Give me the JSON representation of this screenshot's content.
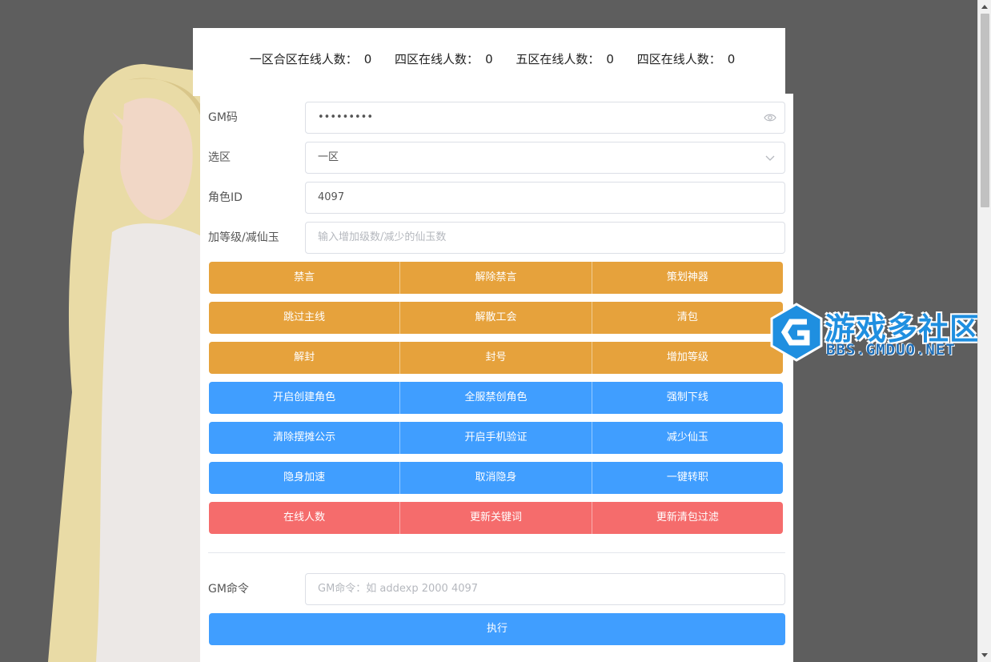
{
  "header": {
    "stats": [
      {
        "label": "一区合区在线人数：",
        "value": "0"
      },
      {
        "label": "四区在线人数：",
        "value": "0"
      },
      {
        "label": "五区在线人数：",
        "value": "0"
      },
      {
        "label": "四区在线人数：",
        "value": "0"
      }
    ]
  },
  "form": {
    "gm_code": {
      "label": "GM码",
      "value": "•••••••••",
      "icon": "eye-icon"
    },
    "zone": {
      "label": "选区",
      "value": "一区",
      "icon": "chevron-down-icon"
    },
    "role_id": {
      "label": "角色ID",
      "value": "4097"
    },
    "level": {
      "label": "加等级/减仙玉",
      "placeholder": "输入增加级数/减少的仙玉数"
    },
    "button_rows": [
      {
        "color": "#e6a23c",
        "buttons": [
          "禁言",
          "解除禁言",
          "策划神器"
        ]
      },
      {
        "color": "#e6a23c",
        "buttons": [
          "跳过主线",
          "解散工会",
          "清包"
        ]
      },
      {
        "color": "#e6a23c",
        "buttons": [
          "解封",
          "封号",
          "增加等级"
        ]
      },
      {
        "color": "#409eff",
        "buttons": [
          "开启创建角色",
          "全服禁创角色",
          "强制下线"
        ]
      },
      {
        "color": "#409eff",
        "buttons": [
          "清除摆摊公示",
          "开启手机验证",
          "减少仙玉"
        ]
      },
      {
        "color": "#409eff",
        "buttons": [
          "隐身加速",
          "取消隐身",
          "一键转职"
        ]
      },
      {
        "color": "#f56c6c",
        "buttons": [
          "在线人数",
          "更新关键词",
          "更新清包过滤"
        ]
      }
    ],
    "gm_command": {
      "label": "GM命令",
      "placeholder": "GM命令：如 addexp 2000 4097"
    },
    "execute_label": "执行"
  },
  "watermark": {
    "title": "游戏多社区",
    "url": "BBS.GMDUO.NET"
  }
}
